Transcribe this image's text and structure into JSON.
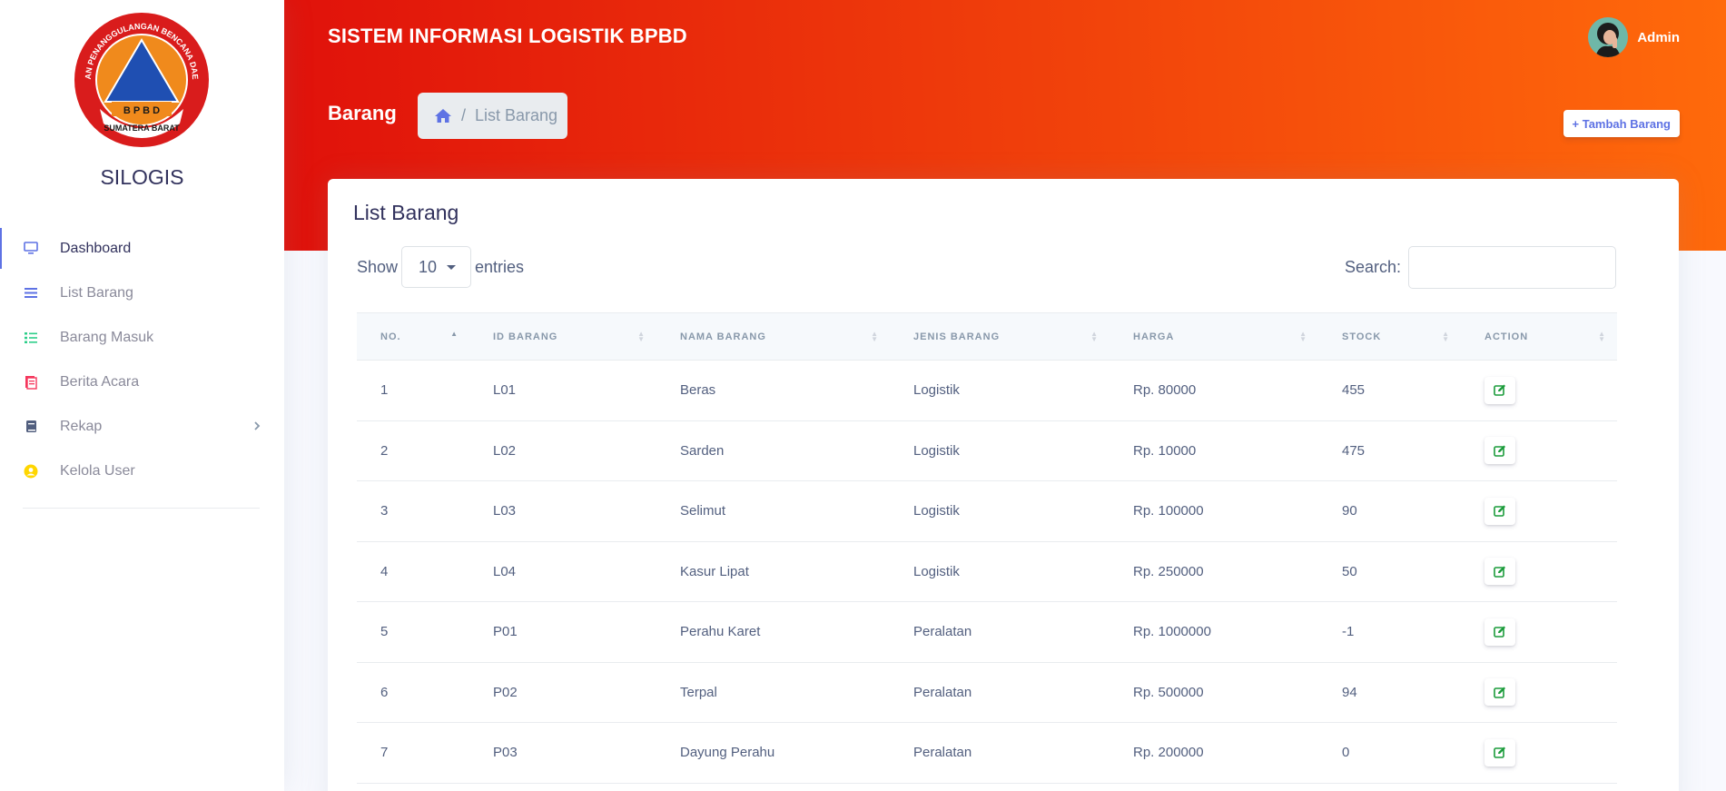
{
  "sidebar": {
    "brand": "SILOGIS",
    "logo": {
      "top_text": "BADAN PENANGGULANGAN BENCANA DAERAH",
      "bottom_text": "SUMATERA BARAT",
      "center_text": "B P B D"
    },
    "items": [
      {
        "label": "Dashboard",
        "icon": "monitor-icon",
        "color": "#5e72e4",
        "active": true
      },
      {
        "label": "List Barang",
        "icon": "list-icon",
        "color": "#5e72e4"
      },
      {
        "label": "Barang Masuk",
        "icon": "checklist-icon",
        "color": "#2dce89"
      },
      {
        "label": "Berita Acara",
        "icon": "document-icon",
        "color": "#f5365c"
      },
      {
        "label": "Rekap",
        "icon": "book-icon",
        "color": "#525f7f",
        "has_submenu": true
      },
      {
        "label": "Kelola User",
        "icon": "user-circle-icon",
        "color": "#ffd600"
      }
    ]
  },
  "header": {
    "title": "SISTEM INFORMASI LOGISTIK BPBD",
    "user_name": "Admin",
    "page_heading": "Barang",
    "breadcrumb": {
      "separator": "/",
      "current": "List Barang"
    },
    "add_button": "+ Tambah Barang",
    "gradient": [
      "#e0110b",
      "#ff6a0b"
    ]
  },
  "card": {
    "title": "List Barang",
    "length": {
      "prefix": "Show",
      "value": "10",
      "suffix": "entries"
    },
    "search": {
      "label": "Search:",
      "value": ""
    },
    "columns": [
      "NO.",
      "ID BARANG",
      "NAMA BARANG",
      "JENIS BARANG",
      "HARGA",
      "STOCK",
      "ACTION"
    ],
    "rows": [
      {
        "no": "1",
        "id": "L01",
        "nama": "Beras",
        "jenis": "Logistik",
        "harga": "Rp. 80000",
        "stock": "455"
      },
      {
        "no": "2",
        "id": "L02",
        "nama": "Sarden",
        "jenis": "Logistik",
        "harga": "Rp. 10000",
        "stock": "475"
      },
      {
        "no": "3",
        "id": "L03",
        "nama": "Selimut",
        "jenis": "Logistik",
        "harga": "Rp. 100000",
        "stock": "90"
      },
      {
        "no": "4",
        "id": "L04",
        "nama": "Kasur Lipat",
        "jenis": "Logistik",
        "harga": "Rp. 250000",
        "stock": "50"
      },
      {
        "no": "5",
        "id": "P01",
        "nama": "Perahu Karet",
        "jenis": "Peralatan",
        "harga": "Rp. 1000000",
        "stock": "-1"
      },
      {
        "no": "6",
        "id": "P02",
        "nama": "Terpal",
        "jenis": "Peralatan",
        "harga": "Rp. 500000",
        "stock": "94"
      },
      {
        "no": "7",
        "id": "P03",
        "nama": "Dayung Perahu",
        "jenis": "Peralatan",
        "harga": "Rp. 200000",
        "stock": "0"
      }
    ]
  }
}
